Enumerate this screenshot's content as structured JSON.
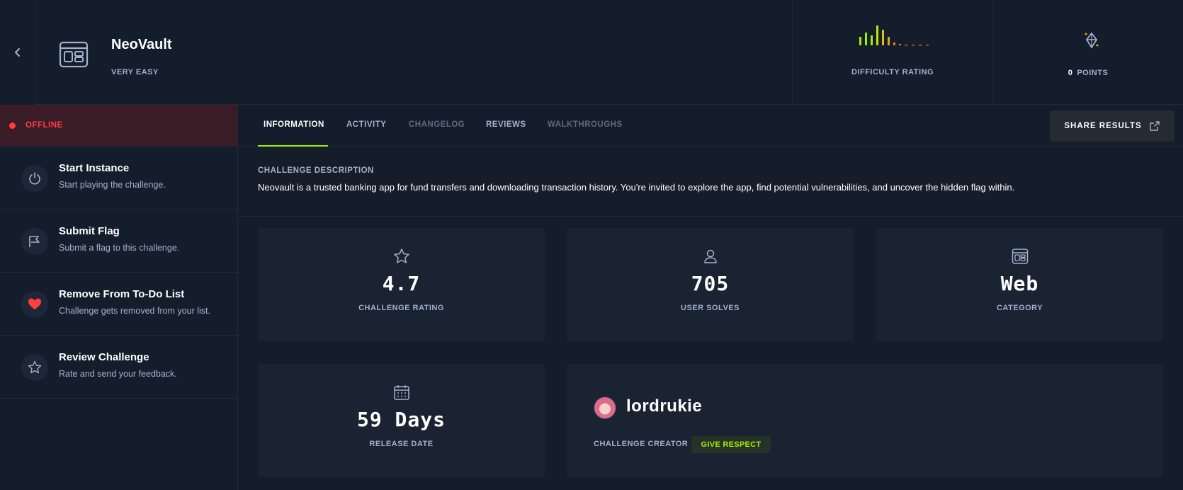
{
  "header": {
    "title": "NeoVault",
    "difficulty": "VERY EASY",
    "difficulty_rating_label": "DIFFICULTY RATING",
    "points_value": "0",
    "points_label": "POINTS"
  },
  "sidebar": {
    "status": "OFFLINE",
    "items": [
      {
        "title": "Start Instance",
        "subtitle": "Start playing the challenge.",
        "icon": "power-icon"
      },
      {
        "title": "Submit Flag",
        "subtitle": "Submit a flag to this challenge.",
        "icon": "flag-icon"
      },
      {
        "title": "Remove From To-Do List",
        "subtitle": "Challenge gets removed from your list.",
        "icon": "heart-icon"
      },
      {
        "title": "Review Challenge",
        "subtitle": "Rate and send your feedback.",
        "icon": "star-icon"
      }
    ]
  },
  "tabs": {
    "items": [
      "INFORMATION",
      "ACTIVITY",
      "CHANGELOG",
      "REVIEWS",
      "WALKTHROUGHS"
    ],
    "share": "SHARE RESULTS"
  },
  "description": {
    "heading": "CHALLENGE DESCRIPTION",
    "text": "Neovault is a trusted banking app for fund transfers and downloading transaction history. You're invited to explore the app, find potential vulnerabilities, and uncover the hidden flag within."
  },
  "stats": {
    "rating": {
      "value": "4.7",
      "label": "CHALLENGE RATING"
    },
    "solves": {
      "value": "705",
      "label": "USER SOLVES"
    },
    "category": {
      "value": "Web",
      "label": "CATEGORY"
    },
    "release": {
      "value": "59 Days",
      "label": "RELEASE DATE"
    }
  },
  "creator": {
    "name": "lordrukie",
    "label": "CHALLENGE CREATOR",
    "respect": "GIVE RESPECT"
  },
  "colors": {
    "accent": "#9fef00",
    "offline": "#ff3e3e",
    "background": "#151d2b",
    "card": "#1a2332"
  }
}
